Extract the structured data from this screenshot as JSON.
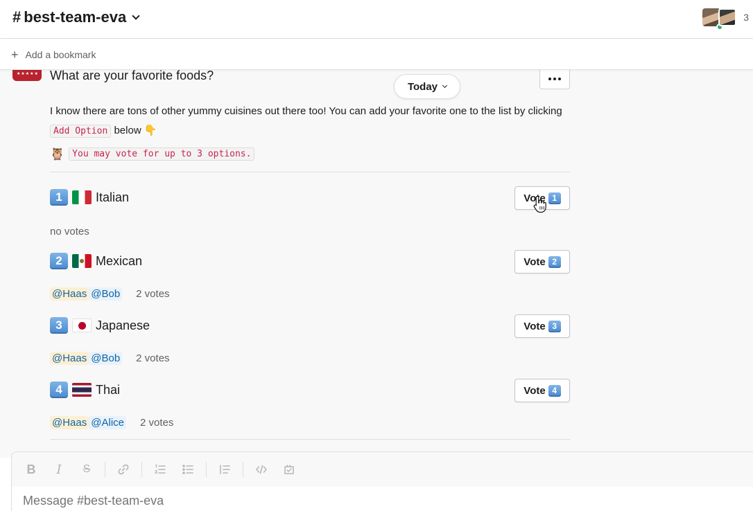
{
  "header": {
    "channel_hash": "#",
    "channel_name": "best-team-eva",
    "member_count": "3"
  },
  "bookmarks": {
    "add_label": "Add a bookmark"
  },
  "poll": {
    "question": "What are your favorite foods?",
    "date_divider": "Today",
    "description_before": "I know there are tons of other yummy cuisines out there too! You can add your favorite one to the list by clicking",
    "description_code": "Add Option",
    "description_after": "below",
    "description_emoji": "👇",
    "owl_emoji": "🦉",
    "limit_note": "You may vote for up to 3 options.",
    "vote_label": "Vote",
    "options": [
      {
        "number": "1",
        "name": "Italian",
        "voters": [],
        "votes_text": "no votes"
      },
      {
        "number": "2",
        "name": "Mexican",
        "voters": [
          "@Haas",
          "@Bob"
        ],
        "votes_text": "2 votes"
      },
      {
        "number": "3",
        "name": "Japanese",
        "voters": [
          "@Haas",
          "@Bob"
        ],
        "votes_text": "2 votes"
      },
      {
        "number": "4",
        "name": "Thai",
        "voters": [
          "@Haas",
          "@Alice"
        ],
        "votes_text": "2 votes"
      }
    ]
  },
  "composer": {
    "placeholder": "Message #best-team-eva",
    "toolbar": [
      "bold",
      "italic",
      "strikethrough",
      "link",
      "ordered-list",
      "bulleted-list",
      "blockquote",
      "code",
      "code-block"
    ]
  },
  "colors": {
    "link": "#1264a3",
    "code": "#c7254e",
    "mention_self_bg": "#fcefd3",
    "presence": "#2bac76"
  }
}
